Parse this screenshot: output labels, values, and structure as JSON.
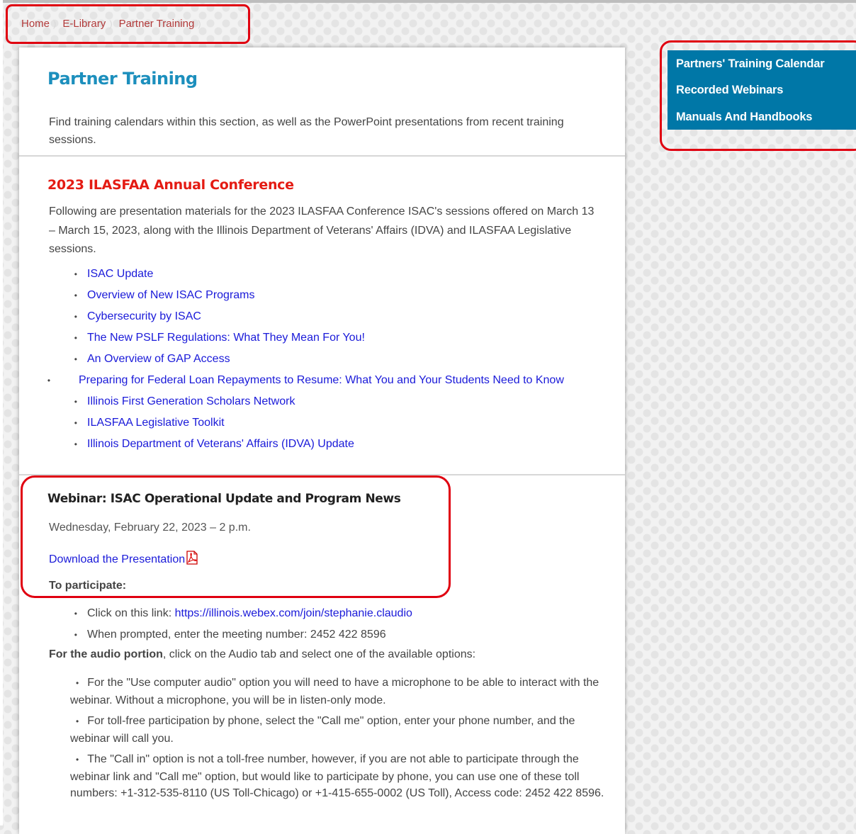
{
  "breadcrumb": {
    "items": [
      {
        "label": "Home"
      },
      {
        "label": "E-Library"
      },
      {
        "label": "Partner Training"
      }
    ],
    "separator": ")"
  },
  "page": {
    "title": "Partner Training",
    "intro": "Find training calendars within this section, as well as the PowerPoint presentations from recent training sessions."
  },
  "conference": {
    "title": "2023 ILASFAA Annual Conference",
    "description": "Following are presentation materials for the 2023 ILASFAA Conference ISAC's sessions offered on March 13 – March 15, 2023, along with the Illinois Department of Veterans' Affairs (IDVA) and ILASFAA Legislative sessions.",
    "links": [
      "ISAC Update",
      "Overview of New ISAC Programs",
      "Cybersecurity by ISAC",
      "The New PSLF Regulations: What They Mean For You!",
      "An Overview of GAP Access",
      "Preparing for Federal Loan Repayments to Resume: What You and Your Students Need to Know",
      "Illinois First Generation Scholars Network",
      "ILASFAA Legislative Toolkit",
      "Illinois Department of Veterans' Affairs (IDVA) Update"
    ]
  },
  "webinar": {
    "title": "Webinar: ISAC Operational Update and Program News",
    "date": "Wednesday, February 22, 2023 – 2 p.m.",
    "download_label": "Download the Presentation",
    "participate_label": "To participate:",
    "join_prefix": "Click on this link: ",
    "join_link": "https://illinois.webex.com/join/stephanie.claudio",
    "meeting_text": "When prompted, enter the meeting number: 2452 422 8596",
    "audio_bold": "For the audio portion",
    "audio_rest": ", click on the Audio tab and select one of the available options:",
    "audio_options": [
      "For the \"Use computer audio\" option you will need to have a microphone to be able to interact with the webinar. Without a microphone, you will be in listen-only mode.",
      "For toll-free participation by phone, select the \"Call me\" option, enter your phone number, and the webinar will call you.",
      "The \"Call in\" option is not a toll-free number, however, if you are not able to participate through the webinar link and \"Call me\" option, but would like to participate by phone, you can use one of these toll numbers: +1-312-535-8110 (US Toll-Chicago) or +1-415-655-0002 (US Toll), Access code: 2452 422 8596."
    ]
  },
  "sidebar": {
    "items": [
      {
        "label": "Partners' Training Calendar"
      },
      {
        "label": "Recorded Webinars"
      },
      {
        "label": "Manuals And Handbooks"
      }
    ]
  },
  "colors": {
    "accent_blue": "#1c8fbd",
    "sidebar_bg": "#0077a7",
    "conference_red": "#e41b13",
    "link_blue": "#1a1ad9",
    "highlight_red": "#e00010"
  }
}
